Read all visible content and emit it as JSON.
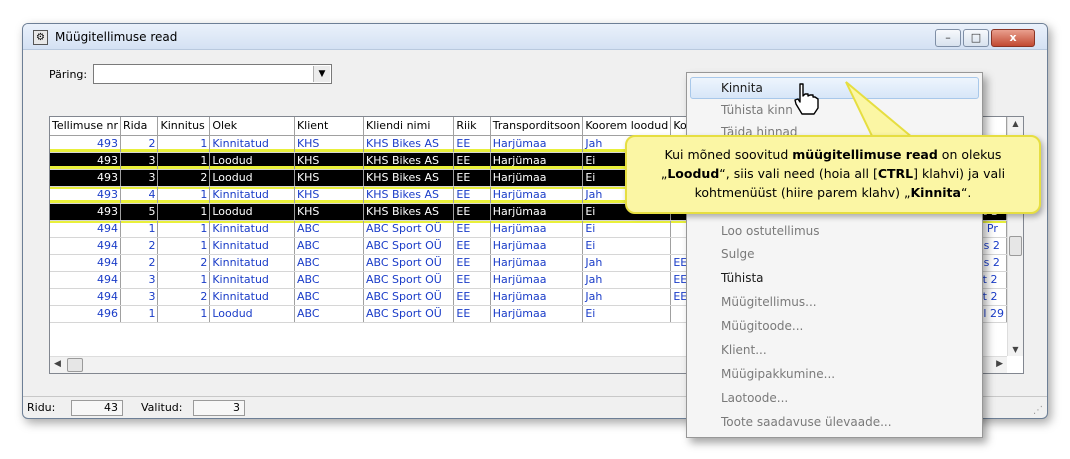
{
  "window": {
    "title": "Müügitellimuse read",
    "min": "–",
    "max": "□",
    "close": "x"
  },
  "query": {
    "label": "Päring:",
    "value": ""
  },
  "columns": [
    "Tellimuse nr",
    "Rida",
    "Kinnitus",
    "Olek",
    "Klient",
    "Kliendi nimi",
    "Riik",
    "Transporditsoon",
    "Koorem loodud",
    "Ko"
  ],
  "rows": [
    {
      "style": "blue",
      "cells": [
        "493",
        "2",
        "1",
        "Kinnitatud",
        "KHS",
        "KHS Bikes AS",
        "EE",
        "Harjümaa",
        "Jah",
        ""
      ]
    },
    {
      "style": "sel",
      "cells": [
        "493",
        "3",
        "1",
        "Loodud",
        "KHS",
        "KHS Bikes AS",
        "EE",
        "Harjümaa",
        "Ei",
        ""
      ]
    },
    {
      "style": "sel",
      "cells": [
        "493",
        "3",
        "2",
        "Loodud",
        "KHS",
        "KHS Bikes AS",
        "EE",
        "Harjümaa",
        "Ei",
        ""
      ]
    },
    {
      "style": "blue",
      "cells": [
        "493",
        "4",
        "1",
        "Kinnitatud",
        "KHS",
        "KHS Bikes AS",
        "EE",
        "Harjümaa",
        "Jah",
        ""
      ]
    },
    {
      "style": "sel",
      "cells": [
        "493",
        "5",
        "1",
        "Loodud",
        "KHS",
        "KHS Bikes AS",
        "EE",
        "Harjümaa",
        "Ei",
        ""
      ]
    },
    {
      "style": "blue",
      "cells": [
        "494",
        "1",
        "1",
        "Kinnitatud",
        "ABC",
        "ABC Sport OÜ",
        "EE",
        "Harjümaa",
        "Ei",
        ""
      ]
    },
    {
      "style": "blue",
      "cells": [
        "494",
        "2",
        "1",
        "Kinnitatud",
        "ABC",
        "ABC Sport OÜ",
        "EE",
        "Harjümaa",
        "Ei",
        ""
      ]
    },
    {
      "style": "blue",
      "cells": [
        "494",
        "2",
        "2",
        "Kinnitatud",
        "ABC",
        "ABC Sport OÜ",
        "EE",
        "Harjümaa",
        "Jah",
        "EE"
      ]
    },
    {
      "style": "blue",
      "cells": [
        "494",
        "3",
        "1",
        "Kinnitatud",
        "ABC",
        "ABC Sport OÜ",
        "EE",
        "Harjümaa",
        "Jah",
        "EE"
      ]
    },
    {
      "style": "blue",
      "cells": [
        "494",
        "3",
        "2",
        "Kinnitatud",
        "ABC",
        "ABC Sport OÜ",
        "EE",
        "Harjümaa",
        "Jah",
        "EE"
      ]
    },
    {
      "style": "blue",
      "cells": [
        "496",
        "1",
        "1",
        "Loodud",
        "ABC",
        "ABC Sport OÜ",
        "EE",
        "Harjümaa",
        "Ei",
        ""
      ]
    }
  ],
  "right_fragments": [
    "",
    "",
    "",
    "",
    "ct 1",
    "e Pr",
    "us 2",
    "us 2",
    "ct 2",
    "ct 2",
    "el 29"
  ],
  "status": {
    "rows_label": "Ridu:",
    "rows_value": "43",
    "selected_label": "Valitud:",
    "selected_value": "3"
  },
  "menu": {
    "items": [
      {
        "label": "Kinnita",
        "enabled": true
      },
      {
        "label": "Tühista kinn",
        "enabled": false
      },
      {
        "label": "Täida hinnad",
        "enabled": false
      },
      {
        "label": "Loo ostutellimus",
        "enabled": false
      },
      {
        "label": "Sulge",
        "enabled": false
      },
      {
        "label": "Tühista",
        "enabled": true
      },
      {
        "label": "Müügitellimus...",
        "enabled": false
      },
      {
        "label": "Müügitoode...",
        "enabled": false
      },
      {
        "label": "Klient...",
        "enabled": false
      },
      {
        "label": "Müügipakkumine...",
        "enabled": false
      },
      {
        "label": "Laotoode...",
        "enabled": false
      },
      {
        "label": "Toote saadavuse ülevaade...",
        "enabled": false
      }
    ]
  },
  "callout": {
    "t1": "Kui mõned soovitud ",
    "b1": "müügitellimuse read",
    "t2": " on olekus",
    "t3": "„",
    "b2": "Loodud",
    "t4": "“, siis vali need (hoia all [",
    "b3": "CTRL",
    "t5": "] klahvi) ja vali",
    "t6": "kohtmenüüst (hiire parem klahv) „",
    "b4": "Kinnita",
    "t7": "“."
  },
  "colors": {
    "selected_row": "#000000",
    "selected_glow": "#e9f03a",
    "confirmed_text": "#1a3cc8",
    "callout_bg": "#fbf6a4"
  }
}
